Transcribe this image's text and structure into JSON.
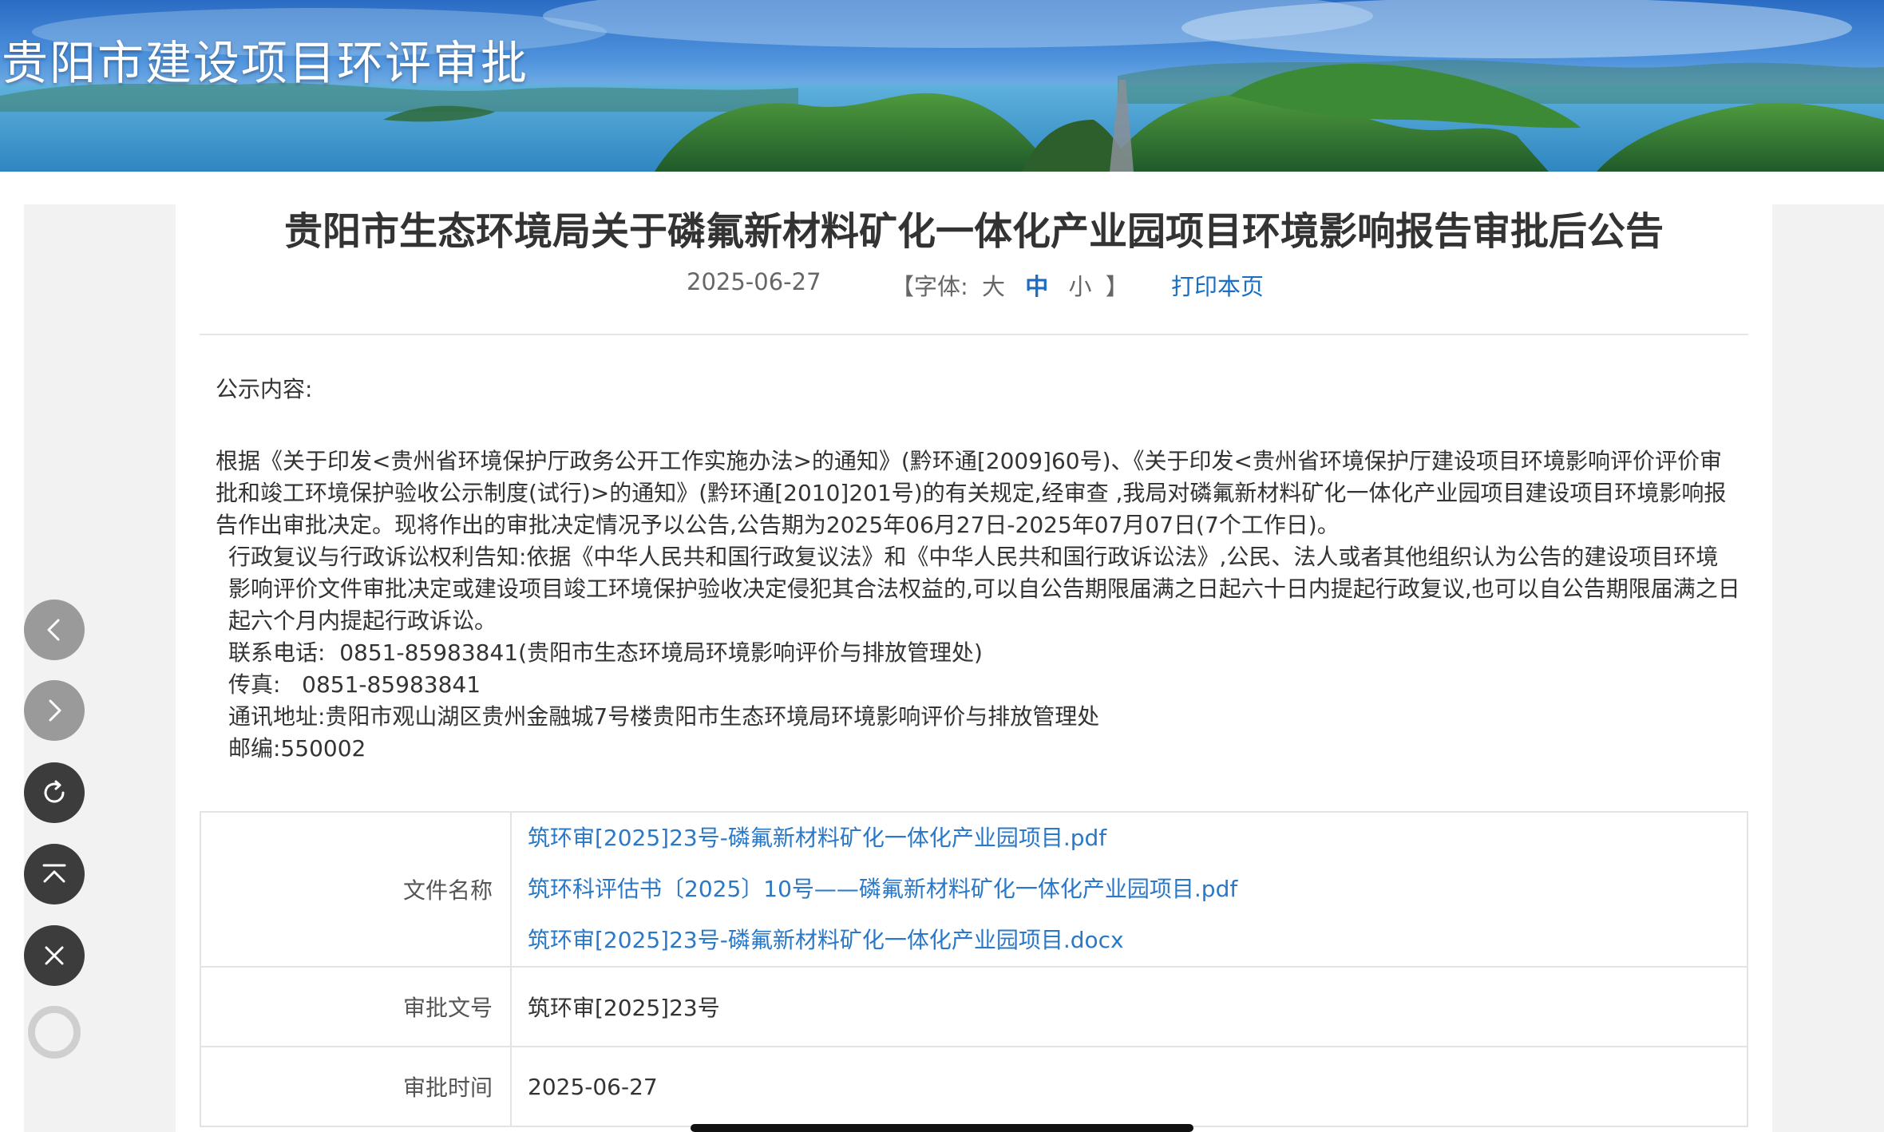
{
  "site": {
    "title": "贵阳市建设项目环评审批"
  },
  "article": {
    "title": "贵阳市生态环境局关于磷氟新材料矿化一体化产业园项目环境影响报告审批后公告",
    "date": "2025-06-27",
    "font_size_label": "【字体:",
    "font_size_options": [
      "大",
      "中",
      "小"
    ],
    "font_size_selected": "中",
    "font_size_close": "】",
    "print_label": "打印本页"
  },
  "content": {
    "heading": "公示内容:",
    "paragraph1": "根据《关于印发<贵州省环境保护厅政务公开工作实施办法>的通知》(黔环通[2009]60号)、《关于印发<贵州省环境保护厅建设项目环境影响评价评价审批和竣工环境保护验收公示制度(试行)>的通知》(黔环通[2010]201号)的有关规定,经审查 ,我局对磷氟新材料矿化一体化产业园项目建设项目环境影响报告作出审批决定。现将作出的审批决定情况予以公告,公告期为2025年06月27日-2025年07月07日(7个工作日)。",
    "paragraph2": "行政复议与行政诉讼权利告知:依据《中华人民共和国行政复议法》和《中华人民共和国行政诉讼法》,公民、法人或者其他组织认为公告的建设项目环境影响评价文件审批决定或建设项目竣工环境保护验收决定侵犯其合法权益的,可以自公告期限届满之日起六十日内提起行政复议,也可以自公告期限届满之日起六个月内提起行政诉讼。",
    "contact_phone": "联系电话:  0851-85983841(贵阳市生态环境局环境影响评价与排放管理处)",
    "fax": "传真:   0851-85983841",
    "address": "通讯地址:贵阳市观山湖区贵州金融城7号楼贵阳市生态环境局环境影响评价与排放管理处",
    "postcode": "邮编:550002"
  },
  "table": {
    "file_label": "文件名称",
    "files": [
      "筑环审[2025]23号-磷氟新材料矿化一体化产业园项目.pdf",
      "筑环科评估书〔2025〕10号——磷氟新材料矿化一体化产业园项目.pdf",
      "筑环审[2025]23号-磷氟新材料矿化一体化产业园项目.docx"
    ],
    "doc_no_label": "审批文号",
    "doc_no": "筑环审[2025]23号",
    "time_label": "审批时间",
    "time": "2025-06-27"
  },
  "controls": {
    "icons": [
      "chevron-left-icon",
      "chevron-right-icon",
      "refresh-icon",
      "scroll-top-icon",
      "close-icon",
      "circle-icon"
    ]
  },
  "colors": {
    "link": "#2a78c6",
    "active_font": "#1a6fc4",
    "gutter": "#f2f2f2",
    "fab_light": "#9a9a9a",
    "fab_dark": "#3c3c3c"
  }
}
